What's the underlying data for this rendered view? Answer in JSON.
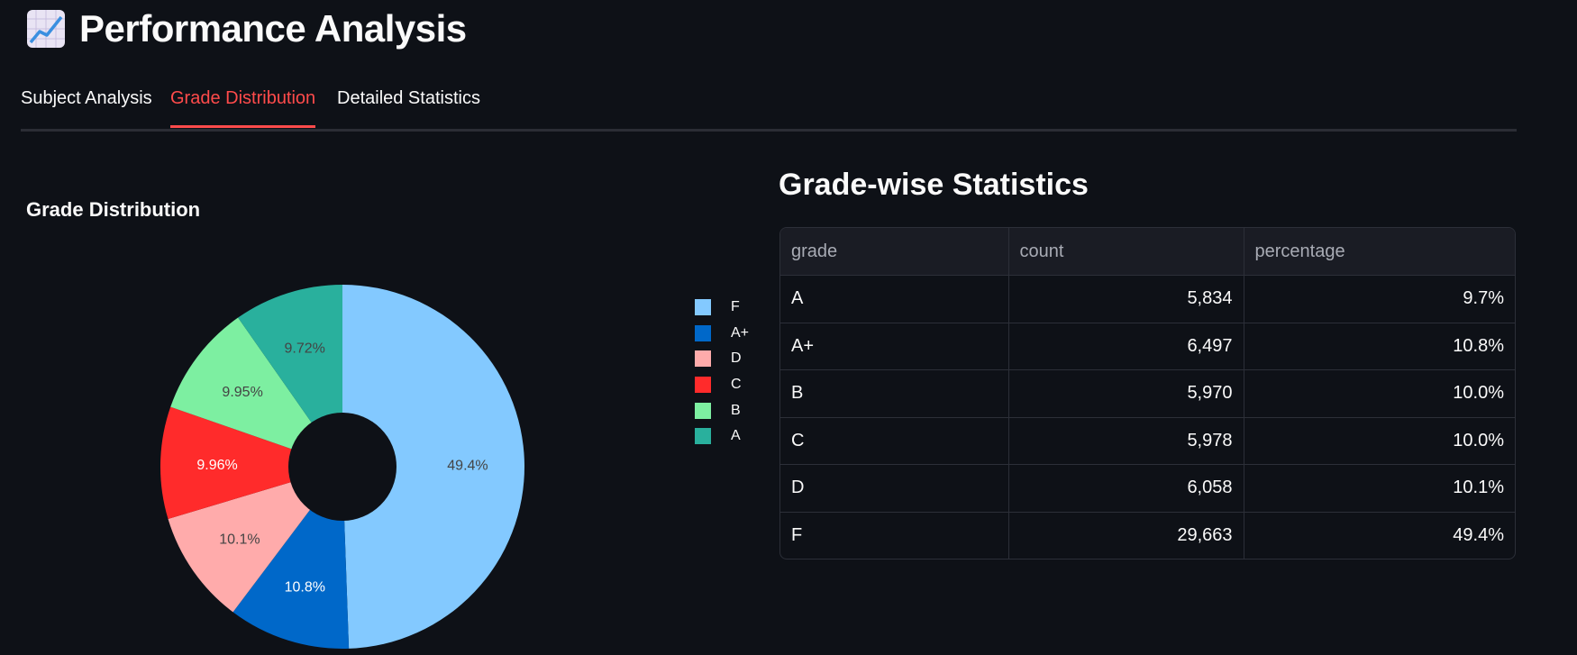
{
  "header": {
    "title": "Performance Analysis",
    "icon": "chart-increasing-icon"
  },
  "tabs": [
    {
      "label": "Subject Analysis",
      "active": false
    },
    {
      "label": "Grade Distribution",
      "active": true
    },
    {
      "label": "Detailed Statistics",
      "active": false
    }
  ],
  "colors": {
    "background": "#0e1117",
    "accent": "#ff4b4b"
  },
  "chart_data": {
    "type": "pie",
    "title": "Grade Distribution",
    "hole": true,
    "slices": [
      {
        "label": "F",
        "value": 29663,
        "percent_label": "49.4%",
        "color": "#83c9ff",
        "text_color": "#444444"
      },
      {
        "label": "A+",
        "value": 6497,
        "percent_label": "10.8%",
        "color": "#0068c9",
        "text_color": "#ffffff"
      },
      {
        "label": "D",
        "value": 6058,
        "percent_label": "10.1%",
        "color": "#ffabab",
        "text_color": "#444444"
      },
      {
        "label": "C",
        "value": 5978,
        "percent_label": "9.96%",
        "color": "#ff2b2b",
        "text_color": "#ffffff"
      },
      {
        "label": "B",
        "value": 5970,
        "percent_label": "9.95%",
        "color": "#7defa1",
        "text_color": "#444444"
      },
      {
        "label": "A",
        "value": 5834,
        "percent_label": "9.72%",
        "color": "#29b09d",
        "text_color": "#444444"
      }
    ],
    "legend_position": "right"
  },
  "stats": {
    "heading": "Grade-wise Statistics",
    "columns": [
      "grade",
      "count",
      "percentage"
    ],
    "rows": [
      [
        "A",
        "5,834",
        "9.7%"
      ],
      [
        "A+",
        "6,497",
        "10.8%"
      ],
      [
        "B",
        "5,970",
        "10.0%"
      ],
      [
        "C",
        "5,978",
        "10.0%"
      ],
      [
        "D",
        "6,058",
        "10.1%"
      ],
      [
        "F",
        "29,663",
        "49.4%"
      ]
    ]
  }
}
